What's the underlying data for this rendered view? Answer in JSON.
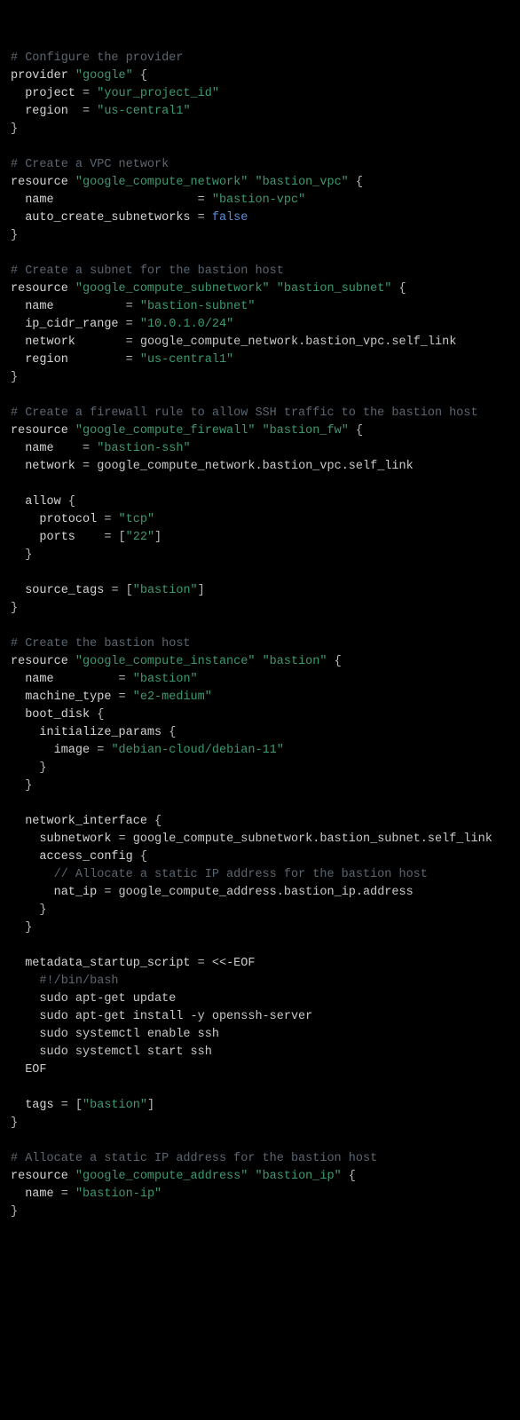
{
  "code": {
    "comments": {
      "c1": "# Configure the provider",
      "c2": "# Create a VPC network",
      "c3": "# Create a subnet for the bastion host",
      "c4": "# Create a firewall rule to allow SSH traffic to the bastion host",
      "c5": "# Create the bastion host",
      "c6": "// Allocate a static IP address for the bastion host",
      "c7": "# Allocate a static IP address for the bastion host"
    },
    "keywords": {
      "provider": "provider",
      "resource": "resource",
      "false": "false"
    },
    "strings": {
      "google": "\"google\"",
      "project_id": "\"your_project_id\"",
      "region": "\"us-central1\"",
      "gcn": "\"google_compute_network\"",
      "bastion_vpc": "\"bastion_vpc\"",
      "bastion_vpc_name": "\"bastion-vpc\"",
      "gcs": "\"google_compute_subnetwork\"",
      "bastion_subnet": "\"bastion_subnet\"",
      "bastion_subnet_name": "\"bastion-subnet\"",
      "cidr": "\"10.0.1.0/24\"",
      "gcf": "\"google_compute_firewall\"",
      "bastion_fw": "\"bastion_fw\"",
      "bastion_ssh": "\"bastion-ssh\"",
      "tcp": "\"tcp\"",
      "port22": "\"22\"",
      "bastion_tag": "\"bastion\"",
      "gci": "\"google_compute_instance\"",
      "bastion": "\"bastion\"",
      "e2medium": "\"e2-medium\"",
      "debian": "\"debian-cloud/debian-11\"",
      "gca": "\"google_compute_address\"",
      "bastion_ip": "\"bastion_ip\"",
      "bastion_ip_name": "\"bastion-ip\""
    },
    "idents": {
      "project": "project",
      "region_k": "region",
      "name": "name",
      "auto_create": "auto_create_subnetworks",
      "ip_cidr": "ip_cidr_range",
      "network": "network",
      "allow": "allow",
      "protocol": "protocol",
      "ports": "ports",
      "source_tags": "source_tags",
      "machine_type": "machine_type",
      "boot_disk": "boot_disk",
      "initialize_params": "initialize_params",
      "image": "image",
      "network_interface": "network_interface",
      "subnetwork": "subnetwork",
      "access_config": "access_config",
      "nat_ip": "nat_ip",
      "metadata_startup_script": "metadata_startup_script",
      "tags": "tags",
      "ref_vpc_link": "google_compute_network.bastion_vpc.self_link",
      "ref_subnet_link": "google_compute_subnetwork.bastion_subnet.self_link",
      "ref_ip_addr": "google_compute_address.bastion_ip.address",
      "eof_start": "<<-EOF",
      "eof_end": "EOF",
      "shebang": "#!/bin/bash",
      "sh1": "sudo apt-get update",
      "sh2": "sudo apt-get install -y openssh-server",
      "sh3": "sudo systemctl enable ssh",
      "sh4": "sudo systemctl start ssh"
    }
  }
}
